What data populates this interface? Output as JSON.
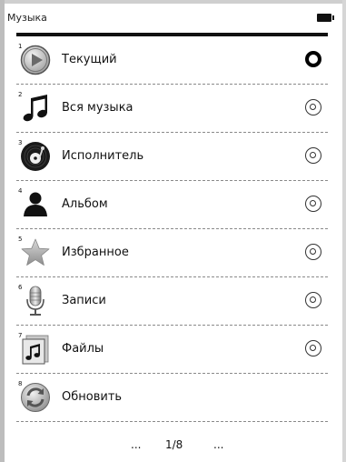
{
  "header": {
    "title": "Музыка"
  },
  "menu": {
    "items": [
      {
        "number": "1",
        "label": "Текущий",
        "icon": "play-icon",
        "selected": true
      },
      {
        "number": "2",
        "label": "Вся музыка",
        "icon": "music-note-icon",
        "selected": false
      },
      {
        "number": "3",
        "label": "Исполнитель",
        "icon": "vinyl-record-icon",
        "selected": false
      },
      {
        "number": "4",
        "label": "Альбом",
        "icon": "person-icon",
        "selected": false
      },
      {
        "number": "5",
        "label": "Избранное",
        "icon": "star-icon",
        "selected": false
      },
      {
        "number": "6",
        "label": "Записи",
        "icon": "microphone-icon",
        "selected": false
      },
      {
        "number": "7",
        "label": "Файлы",
        "icon": "music-file-icon",
        "selected": false
      },
      {
        "number": "8",
        "label": "Обновить",
        "icon": "refresh-icon"
      }
    ]
  },
  "pager": {
    "prev": "...",
    "page": "1/8",
    "next": "..."
  }
}
